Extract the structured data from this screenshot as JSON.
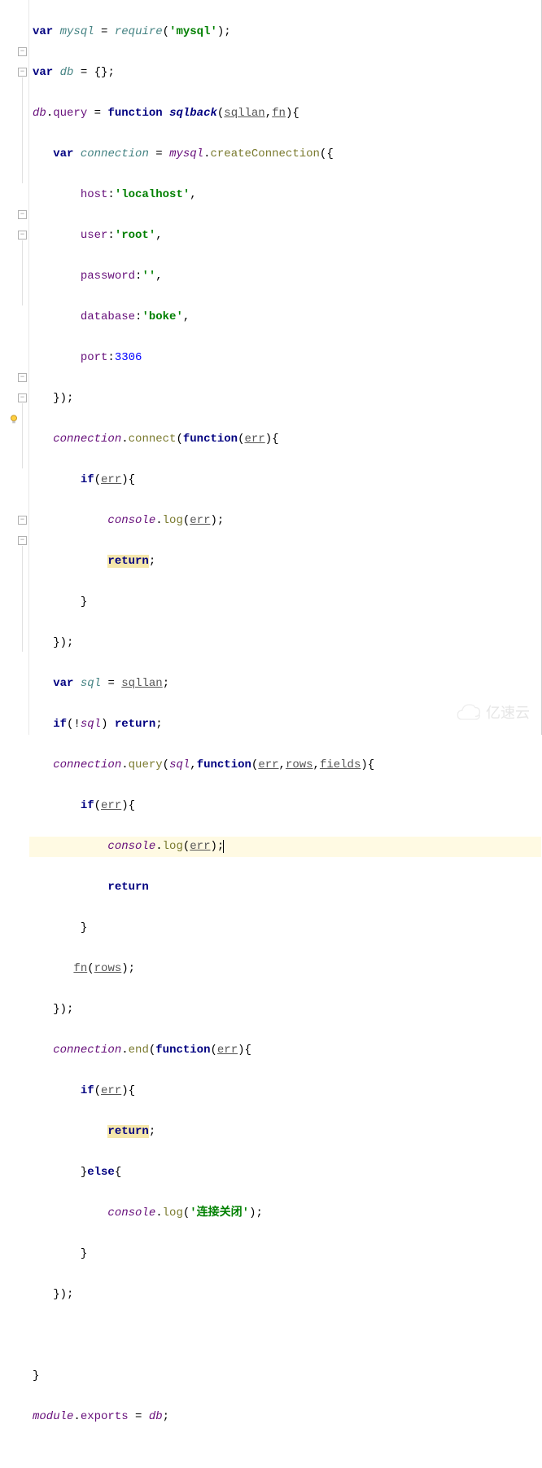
{
  "code": {
    "l1": {
      "kw_var": "var",
      "v_mysql": "mysql",
      "eq": " = ",
      "fn_req": "require",
      "op": "(",
      "str": "'mysql'",
      "cp": ");"
    },
    "l2": {
      "kw_var": "var",
      "v_db": "db",
      "rest": " = {};"
    },
    "l3": {
      "v_db": "db",
      "dot": ".",
      "prop": "query",
      "eq": " = ",
      "kw_fn": "function",
      "fn_name": "sqlback",
      "op": "(",
      "p1": "sqllan",
      "comma": ",",
      "p2": "fn",
      "cp": "){"
    },
    "l4": {
      "kw_var": "var",
      "v_conn": "connection",
      "eq": " = ",
      "v_mysql": "mysql",
      "dot": ".",
      "method": "createConnection",
      "rest": "({"
    },
    "l5": {
      "prop": "host",
      "colon": ":",
      "str": "'localhost'",
      "comma": ","
    },
    "l6": {
      "prop": "user",
      "colon": ":",
      "str": "'root'",
      "comma": ","
    },
    "l7": {
      "prop": "password",
      "colon": ":",
      "str": "''",
      "comma": ","
    },
    "l8": {
      "prop": "database",
      "colon": ":",
      "str": "'boke'",
      "comma": ","
    },
    "l9": {
      "prop": "port",
      "colon": ":",
      "num": "3306"
    },
    "l10": {
      "text": "});"
    },
    "l11": {
      "v_conn": "connection",
      "dot": ".",
      "method": "connect",
      "op": "(",
      "kw_fn": "function",
      "op2": "(",
      "p1": "err",
      "cp": "){"
    },
    "l12": {
      "kw_if": "if",
      "op": "(",
      "p1": "err",
      "cp": "){"
    },
    "l13": {
      "obj": "console",
      "dot": ".",
      "method": "log",
      "op": "(",
      "p1": "err",
      "cp": ");"
    },
    "l14": {
      "kw_ret": "return",
      "semi": ";"
    },
    "l15": {
      "text": "}"
    },
    "l16": {
      "text": "});"
    },
    "l17": {
      "kw_var": "var",
      "v_sql": "sql",
      "eq": " = ",
      "p1": "sqllan",
      "semi": ";"
    },
    "l18": {
      "kw_if": "if",
      "op": "(!",
      "v_sql": "sql",
      "cp": ") ",
      "kw_ret": "return",
      "semi": ";"
    },
    "l19": {
      "v_conn": "connection",
      "dot": ".",
      "method": "query",
      "op": "(",
      "v_sql": "sql",
      "comma": ",",
      "kw_fn": "function",
      "op2": "(",
      "p1": "err",
      "c1": ",",
      "p2": "rows",
      "c2": ",",
      "p3": "fields",
      "cp": "){"
    },
    "l20": {
      "kw_if": "if",
      "op": "(",
      "p1": "err",
      "cp": "){"
    },
    "l21": {
      "obj": "console",
      "dot": ".",
      "method": "log",
      "op": "(",
      "p1": "err",
      "cp": ");"
    },
    "l22": {
      "kw_ret": "return"
    },
    "l23": {
      "text": "}"
    },
    "l24": {
      "p_fn": "fn",
      "op": "(",
      "p1": "rows",
      "cp": ");"
    },
    "l25": {
      "text": "});"
    },
    "l26": {
      "v_conn": "connection",
      "dot": ".",
      "method": "end",
      "op": "(",
      "kw_fn": "function",
      "op2": "(",
      "p1": "err",
      "cp": "){"
    },
    "l27": {
      "kw_if": "if",
      "op": "(",
      "p1": "err",
      "cp": "){"
    },
    "l28": {
      "kw_ret": "return",
      "semi": ";"
    },
    "l29": {
      "cb": "}",
      "kw_else": "else",
      "ob": "{"
    },
    "l30": {
      "obj": "console",
      "dot": ".",
      "method": "log",
      "op": "(",
      "str": "'连接关闭'",
      "cp": ");"
    },
    "l31": {
      "text": "}"
    },
    "l32": {
      "text": "});"
    },
    "l33": {
      "text": ""
    },
    "l34": {
      "text": "}"
    },
    "l35": {
      "obj": "module",
      "dot": ".",
      "prop": "exports",
      "eq": " = ",
      "v_db": "db",
      "semi": ";"
    }
  },
  "watermark": "亿速云"
}
